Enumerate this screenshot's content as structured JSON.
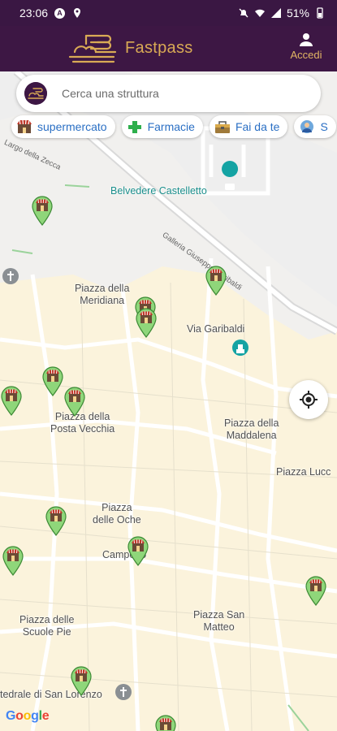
{
  "status_bar": {
    "time": "23:06",
    "battery": "51%"
  },
  "app_bar": {
    "title": "Fastpass",
    "login_label": "Accedi",
    "logo_icon": "fastpass-logo"
  },
  "search": {
    "placeholder": "Cerca una struttura"
  },
  "categories": [
    {
      "label": "supermercato",
      "icon": "shop-icon"
    },
    {
      "label": "Farmacie",
      "icon": "pharmacy-cross-icon"
    },
    {
      "label": "Fai da te",
      "icon": "toolbox-icon"
    },
    {
      "label": "S",
      "icon": "person-icon"
    }
  ],
  "map": {
    "labels": {
      "belvedere": "Belvedere Castelletto",
      "meridiana": "Piazza della\nMeridiana",
      "garibaldi": "Via Garibaldi",
      "posta_vecchia": "Piazza della\nPosta Vecchia",
      "maddalena": "Piazza della\nMaddalena",
      "luccoli": "Piazza Lucc",
      "oche": "Piazza\ndelle Oche",
      "campetto": "Campetto",
      "scuole_pie": "Piazza delle\nScuole Pie",
      "san_matteo": "Piazza San\nMatteo",
      "san_lorenzo": "tedrale di San Lorenzo"
    },
    "streets": {
      "largo_zecca": "Largo della Zecca",
      "galleria": "Galleria Giuseppe Garibaldi"
    },
    "attribution": "Google",
    "colors": {
      "marker": "#8fd67a",
      "marker_stroke": "#3d8a35",
      "accent": "#3d1744",
      "gold": "#d9aa55"
    }
  }
}
